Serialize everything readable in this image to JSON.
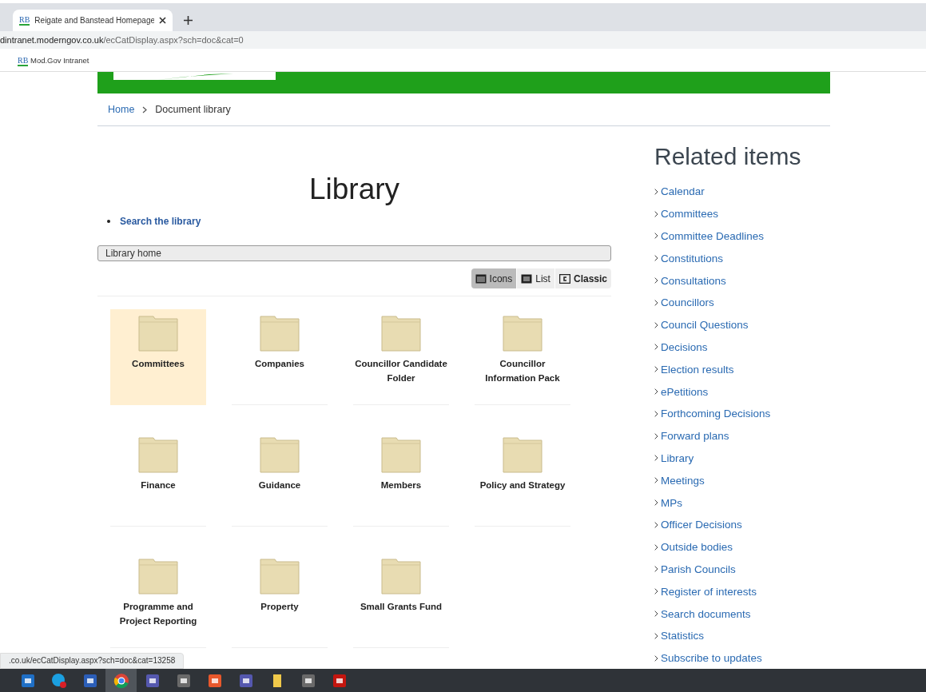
{
  "browser": {
    "tab": {
      "title": "Reigate and Banstead Homepage",
      "logo": "RB"
    },
    "address": {
      "host": "dintranet.moderngov.co.uk",
      "path": "/ecCatDisplay.aspx?sch=doc&cat=0"
    },
    "bookmarks": [
      {
        "logo": "RB",
        "label": "Mod.Gov Intranet"
      }
    ],
    "status_url": ".co.uk/ecCatDisplay.aspx?sch=doc&cat=13258"
  },
  "breadcrumb": [
    "Home",
    "Document library"
  ],
  "main": {
    "title": "Library",
    "links": [
      "Search the library"
    ],
    "path": "Library home",
    "view_buttons": [
      {
        "kind": "icons",
        "label": "Icons",
        "selected": true
      },
      {
        "kind": "list",
        "label": "List",
        "selected": false
      },
      {
        "kind": "classic",
        "label": "Classic",
        "selected": false
      }
    ],
    "folders": [
      {
        "name": "Committees",
        "selected": true
      },
      {
        "name": "Companies",
        "selected": false
      },
      {
        "name": "Councillor Candidate Folder",
        "selected": false
      },
      {
        "name": "Councillor Information Pack",
        "selected": false
      },
      {
        "name": "Finance",
        "selected": false
      },
      {
        "name": "Guidance",
        "selected": false
      },
      {
        "name": "Members",
        "selected": false
      },
      {
        "name": "Policy and Strategy",
        "selected": false
      },
      {
        "name": "Programme and Project Reporting",
        "selected": false
      },
      {
        "name": "Property",
        "selected": false
      },
      {
        "name": "Small Grants Fund",
        "selected": false
      }
    ]
  },
  "related": {
    "title": "Related items",
    "items": [
      "Calendar",
      "Committees",
      "Committee Deadlines",
      "Constitutions",
      "Consultations",
      "Councillors",
      "Council Questions",
      "Decisions",
      "Election results",
      "ePetitions",
      "Forthcoming Decisions",
      "Forward plans",
      "Library",
      "Meetings",
      "MPs",
      "Officer Decisions",
      "Outside bodies",
      "Parish Councils",
      "Register of interests",
      "Search documents",
      "Statistics",
      "Subscribe to updates"
    ]
  },
  "taskbar": [
    {
      "kind": "mail",
      "active": false
    },
    {
      "kind": "chat",
      "active": false
    },
    {
      "kind": "word",
      "active": false
    },
    {
      "kind": "browser",
      "active": true
    },
    {
      "kind": "teams",
      "active": false
    },
    {
      "kind": "tool",
      "active": false
    },
    {
      "kind": "clock",
      "active": false
    },
    {
      "kind": "teams",
      "active": false
    },
    {
      "kind": "folder",
      "active": false
    },
    {
      "kind": "tool",
      "active": false
    },
    {
      "kind": "pdf",
      "active": false
    }
  ]
}
